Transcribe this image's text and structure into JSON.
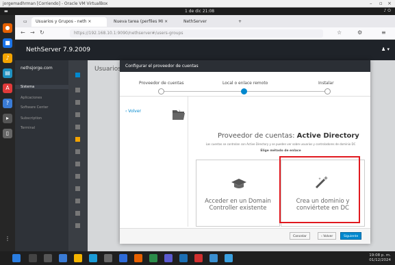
{
  "vbox": {
    "title": "jorgemadhrman [Corriendo] - Oracle VM VirtualBox"
  },
  "guest_bar": {
    "activities": "▬",
    "clock": "1 de dic 21:08"
  },
  "browser": {
    "tabs": [
      {
        "label": "Usuarios y Grupos - neth ×"
      },
      {
        "label": "Nueva tarea (perfiles MI ×"
      },
      {
        "label": "NethServer"
      }
    ],
    "url": "https://192.168.10.1:9090/nethserver#/users-groups"
  },
  "nethserver": {
    "brand": "NethServer 7.9.2009",
    "hostname": "nethsjorge.com",
    "sidebar": [
      "Sistema",
      "Aplicaciones",
      "Software Center",
      "Subscription",
      "Terminal"
    ],
    "main_title": "Usuarios"
  },
  "modal": {
    "title": "Configurar el proveedor de cuentas",
    "steps": [
      "Proveedor de cuentas",
      "Local o enlace remoto",
      "Instalar"
    ],
    "side_link": "‹ Volver",
    "provider_prefix": "Proveedor de cuentas:",
    "provider_name": "Active Directory",
    "description": "Las cuentas se controlan con Active Directory y se pueden ver sobre usuarios y controladores de dominio DC",
    "choose": "Elige método de enlace",
    "card_remote": "Acceder en un Domain Controller existente",
    "card_local": "Crea un dominio y conviértete en DC",
    "cancel": "Cancelar",
    "back": "‹ Volver",
    "next": "Siguiente"
  },
  "taskbar": {
    "time": "19:08 p. m.",
    "date": "01/12/2024"
  },
  "colors": {
    "accent": "#0088ce",
    "highlight": "#e0181e"
  }
}
